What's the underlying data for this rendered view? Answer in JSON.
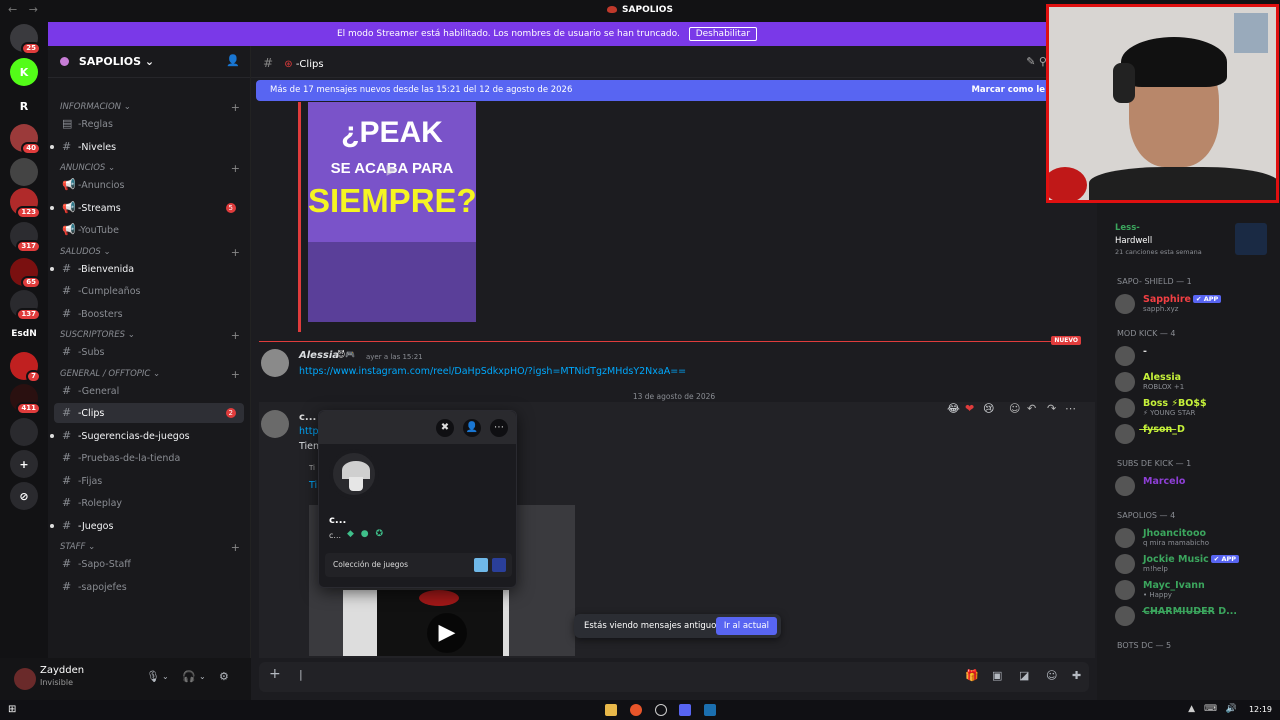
{
  "window": {
    "title": "SAPOLIOS",
    "nav": "← →"
  },
  "streamer_banner": {
    "text": "El modo Streamer está habilitado. Los nombres de usuario se han truncado.",
    "button": "Deshabilitar"
  },
  "server_rail": [
    {
      "label": "",
      "badge": "25",
      "color": "#3a3a3e"
    },
    {
      "label": "K",
      "badge": "",
      "color": "#53fc18"
    },
    {
      "label": "R",
      "badge": "",
      "color": "#121214"
    },
    {
      "label": "",
      "badge": "40",
      "color": "#9b3a3a"
    },
    {
      "label": "",
      "badge": "",
      "color": "#444"
    },
    {
      "label": "",
      "badge": "123",
      "color": "#b02a2a"
    },
    {
      "label": "",
      "badge": "317",
      "color": "#2c2c30"
    },
    {
      "label": "",
      "badge": "65",
      "color": "#7a1010"
    },
    {
      "label": "",
      "badge": "137",
      "color": "#2a2a2e"
    },
    {
      "label": "EsdN",
      "badge": "",
      "color": "#121214"
    },
    {
      "label": "",
      "badge": "7",
      "color": "#c02020"
    },
    {
      "label": "",
      "badge": "411",
      "color": "#2a1010"
    },
    {
      "label": "",
      "badge": "",
      "color": "#2a2a2e"
    },
    {
      "label": "+",
      "badge": "",
      "color": "#2a2a2e"
    },
    {
      "label": "⊘",
      "badge": "",
      "color": "#2a2a2e"
    }
  ],
  "server": {
    "name": "SAPOLIOS"
  },
  "categories": [
    {
      "name": "INFORMACION",
      "channels": [
        {
          "name": "-Reglas",
          "glyph": "▤",
          "unread": false
        },
        {
          "name": "-Niveles",
          "glyph": "#",
          "unread": true
        }
      ]
    },
    {
      "name": "ANUNCIOS",
      "channels": [
        {
          "name": "-Anuncios",
          "glyph": "📢",
          "unread": false
        },
        {
          "name": "-Streams",
          "glyph": "📢",
          "unread": true,
          "count": "5"
        },
        {
          "name": "-YouTube",
          "glyph": "📢",
          "unread": false
        }
      ]
    },
    {
      "name": "SALUDOS",
      "channels": [
        {
          "name": "-Bienvenida",
          "glyph": "#",
          "unread": true
        },
        {
          "name": "-Cumpleaños",
          "glyph": "#",
          "unread": false
        },
        {
          "name": "-Boosters",
          "glyph": "#",
          "unread": false
        }
      ]
    },
    {
      "name": "SUSCRIPTORES",
      "channels": [
        {
          "name": "-Subs",
          "glyph": "#",
          "unread": false
        }
      ]
    },
    {
      "name": "GENERAL / OFFTOPIC",
      "channels": [
        {
          "name": "-General",
          "glyph": "#",
          "unread": false
        },
        {
          "name": "-Clips",
          "glyph": "#",
          "unread": true,
          "active": true,
          "count": "2"
        },
        {
          "name": "-Sugerencias-de-juegos",
          "glyph": "#",
          "unread": true
        },
        {
          "name": "-Pruebas-de-la-tienda",
          "glyph": "#",
          "unread": false
        },
        {
          "name": "-Fijas",
          "glyph": "#",
          "unread": false
        },
        {
          "name": "-Roleplay",
          "glyph": "#",
          "unread": false
        },
        {
          "name": "-Juegos",
          "glyph": "#",
          "unread": true
        }
      ]
    },
    {
      "name": "STAFF",
      "channels": [
        {
          "name": "-Sapo-Staff",
          "glyph": "#",
          "unread": false
        },
        {
          "name": "-sapojefes",
          "glyph": "#",
          "unread": false
        }
      ]
    }
  ],
  "user": {
    "name": "Zaydden",
    "status": "Invisible"
  },
  "channel_header": {
    "name": "-Clips"
  },
  "new_messages": {
    "text": "Más de 17 mensajes nuevos desde las 15:21 del 12 de agosto de 2026",
    "action": "Marcar como le"
  },
  "embed_thumbnail": {
    "line1": "¿PEAK",
    "line2": "SE ACABA PARA",
    "line3": "SIEMPRE?"
  },
  "new_divider": "NUEVO",
  "message1": {
    "author": "Alessia",
    "author_color": "#c6f23a",
    "time": "ayer a las 15:21",
    "link": "https://www.instagram.com/reel/DaHpSdkxpHO/?igsh=MTNidTgzMHdsY2NxaA=="
  },
  "date_separator": "13 de agosto de 2026",
  "message2": {
    "author": "c...",
    "link_partial": "http",
    "text_partial": "Tien",
    "embed_label": "Ti"
  },
  "profile_popup": {
    "name": "c...",
    "username": "c...",
    "collection": "Colección de juegos"
  },
  "old_messages": {
    "text": "Estás viendo mensajes antiguos",
    "button": "Ir al actual"
  },
  "activity": {
    "title": "Less-",
    "subtitle": "Hardwell",
    "stat": "21 canciones esta semana"
  },
  "member_groups": [
    {
      "name": "SAPO- SHIELD — 1",
      "members": [
        {
          "name": "Sapphire",
          "color": "#f23f43",
          "tag": "APP",
          "status": "sapph.xyz"
        }
      ]
    },
    {
      "name": "MOD KICK — 4",
      "members": [
        {
          "name": "-",
          "color": "#ddd",
          "tag": "",
          "status": ""
        },
        {
          "name": "Alessia",
          "color": "#c6f23a",
          "tag": "",
          "status": "ROBLOX +1"
        },
        {
          "name": "Boss ⚡BO$$",
          "color": "#c6f23a",
          "tag": "",
          "status": "⚡ YOUNG STAR"
        },
        {
          "name": "f̶y̶s̶o̶n̶_̶D",
          "color": "#c6f23a",
          "tag": "",
          "status": ""
        }
      ]
    },
    {
      "name": "SUBS DE KICK — 1",
      "members": [
        {
          "name": "Marcelo",
          "color": "#8e3fd6",
          "tag": "",
          "status": ""
        }
      ]
    },
    {
      "name": "SAPOLIOS — 4",
      "members": [
        {
          "name": "Jhoancitooo",
          "color": "#3ba55d",
          "tag": "",
          "status": "q mira mamabicho"
        },
        {
          "name": "Jockie Music",
          "color": "#3ba55d",
          "tag": "APP",
          "status": "m!help"
        },
        {
          "name": "Mayc_Ivann",
          "color": "#3ba55d",
          "tag": "",
          "status": "• Happy"
        },
        {
          "name": "C̶H̶A̶R̶M̶I̶U̶D̶E̶R̶ D...",
          "color": "#3ba55d",
          "tag": "",
          "status": ""
        }
      ]
    },
    {
      "name": "BOTS DC — 5",
      "members": []
    }
  ],
  "taskbar": {
    "clock": "12:19"
  }
}
